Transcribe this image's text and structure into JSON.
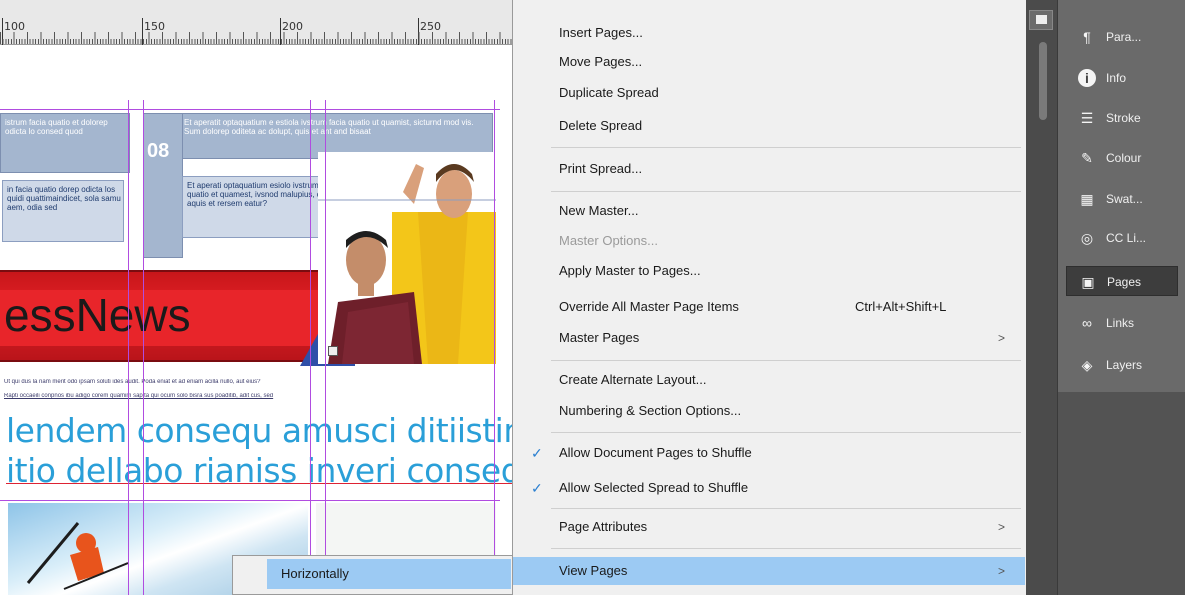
{
  "ruler": {
    "marks": [
      "100",
      "150",
      "200",
      "250"
    ]
  },
  "document": {
    "num_badge": "08",
    "masthead": "essNews",
    "headline_line1": "lendem consequ amusci ditiistincto",
    "headline_line2": "itio dellabo rianiss inveri consequat",
    "fine_print_1": "Ut qui dus la nam merit odo ipsam soluti ides audit. Poda eniat et ad eniam acilla nullo, aut eius?",
    "fine_print_2": "Rapti occaeili conpnos ibu adigo corem quamim sapita qui ocum solo bisra sus poaditib, adit cus, sed",
    "box_text_1": "istrum facia quatio et dolorep odicta lo consed quod",
    "box_text_2": "Et aperatit optaquatium e estiola ivstrum facia quatio ut quamist, sicturnd mod vis. Sum dolorep oditeta ac dolupt, quis et ant and bisaat",
    "panel_text_1": "in facia quatio dorep odicta los quidi quattimaindicet, sola samu aem, odia sed",
    "panel_text_2": "Et aperati optaquatium esiolo ivstrum facia quatio et quamest, ivsnod malupius, dolupt aquis et rersem eatur?"
  },
  "menu": {
    "items": [
      {
        "label": "Insert Pages...",
        "enabled": true
      },
      {
        "label": "Move Pages...",
        "enabled": true
      },
      {
        "label": "Duplicate Spread",
        "enabled": true
      },
      {
        "label": "Delete Spread",
        "enabled": true
      },
      {
        "label": "Print Spread...",
        "enabled": true
      },
      {
        "label": "New Master...",
        "enabled": true
      },
      {
        "label": "Master Options...",
        "enabled": false
      },
      {
        "label": "Apply Master to Pages...",
        "enabled": true
      },
      {
        "label": "Override All Master Page Items",
        "shortcut": "Ctrl+Alt+Shift+L",
        "enabled": true
      },
      {
        "label": "Master Pages",
        "submenu": true,
        "enabled": true
      },
      {
        "label": "Create Alternate Layout...",
        "enabled": true
      },
      {
        "label": "Numbering & Section Options...",
        "enabled": true
      },
      {
        "label": "Allow Document Pages to Shuffle",
        "checked": true,
        "enabled": true
      },
      {
        "label": "Allow Selected Spread to Shuffle",
        "checked": true,
        "enabled": true
      },
      {
        "label": "Page Attributes",
        "submenu": true,
        "enabled": true
      },
      {
        "label": "View Pages",
        "submenu": true,
        "highlighted": true,
        "enabled": true
      }
    ],
    "check_glyph": "✓",
    "arrow_glyph": ">"
  },
  "submenu": {
    "items": [
      {
        "label": "Horizontally",
        "highlighted": true
      }
    ]
  },
  "panels": {
    "items": [
      {
        "label": "Para...",
        "icon": "paragraph-icon",
        "glyph": "¶"
      },
      {
        "label": "Info",
        "icon": "info-icon",
        "glyph": "i"
      },
      {
        "label": "Stroke",
        "icon": "stroke-icon",
        "glyph": "☰"
      },
      {
        "label": "Colour",
        "icon": "colour-icon",
        "glyph": "✎"
      },
      {
        "label": "Swat...",
        "icon": "swatches-icon",
        "glyph": "▦"
      },
      {
        "label": "CC Li...",
        "icon": "cc-libraries-icon",
        "glyph": "◎"
      },
      {
        "label": "Pages",
        "icon": "pages-icon",
        "glyph": "▣",
        "active": true
      },
      {
        "label": "Links",
        "icon": "links-icon",
        "glyph": "∞"
      },
      {
        "label": "Layers",
        "icon": "layers-icon",
        "glyph": "◈"
      }
    ]
  },
  "colors": {
    "menu_highlight": "#9ccaf3",
    "check": "#2a7fd0",
    "headline": "#2a9fd8",
    "banner_red": "#e12126",
    "guide": "#b04ce0"
  }
}
